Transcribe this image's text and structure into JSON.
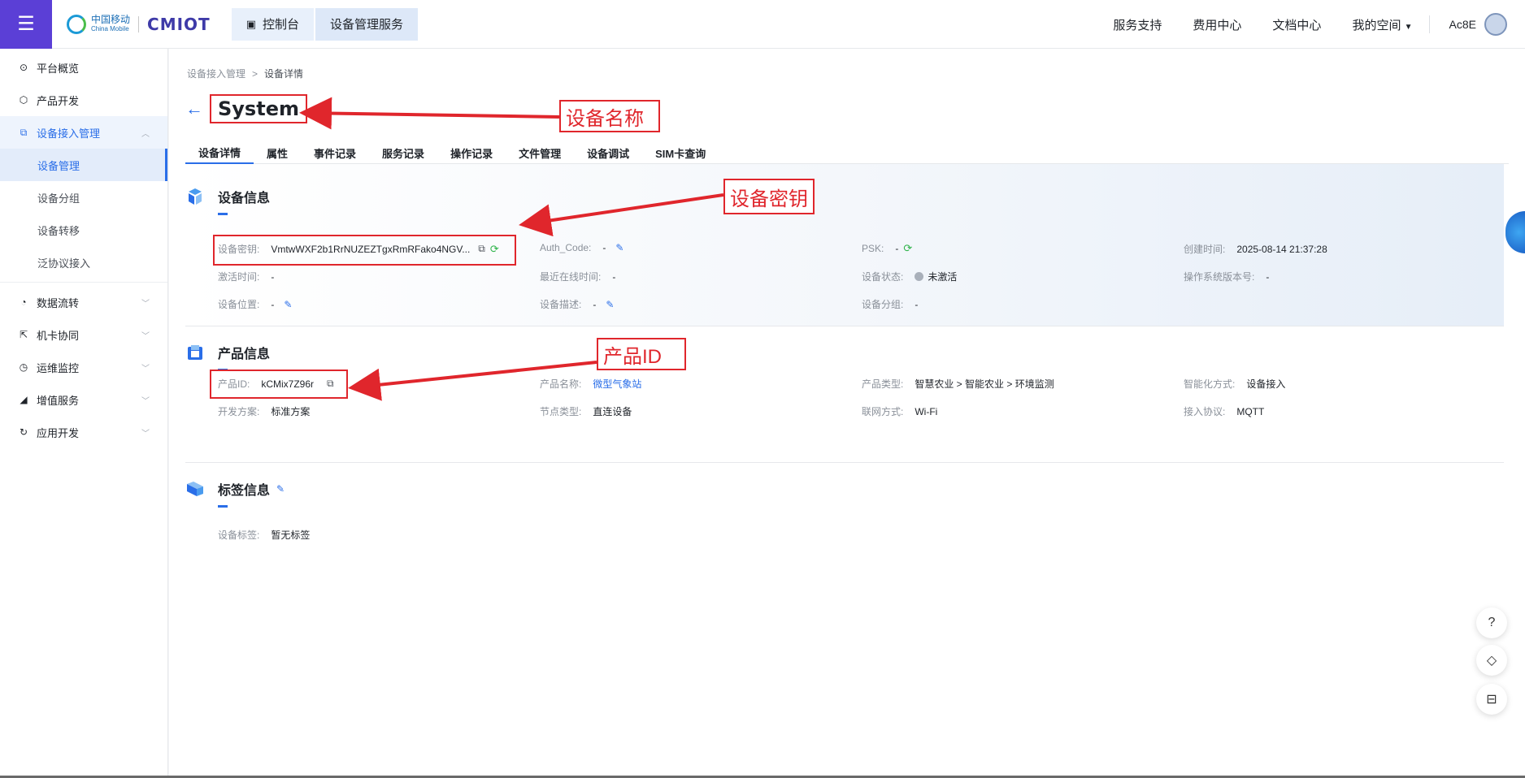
{
  "header": {
    "logo_cn": "中国移动",
    "logo_en": "China Mobile",
    "brand": "CMIOT",
    "crumbs": [
      "控制台",
      "设备管理服务"
    ],
    "links": [
      "服务支持",
      "费用中心",
      "文档中心",
      "我的空间"
    ],
    "username": "Ac8E"
  },
  "sidebar": {
    "items": [
      {
        "label": "平台概览",
        "icon": "dashboard-icon"
      },
      {
        "label": "产品开发",
        "icon": "cube-icon"
      },
      {
        "label": "设备接入管理",
        "icon": "device-icon"
      }
    ],
    "subitems": [
      "设备管理",
      "设备分组",
      "设备转移",
      "泛协议接入"
    ],
    "groups": [
      {
        "label": "数据流转",
        "icon": "flow-icon"
      },
      {
        "label": "机卡协同",
        "icon": "link-icon"
      },
      {
        "label": "运维监控",
        "icon": "monitor-icon"
      },
      {
        "label": "增值服务",
        "icon": "service-icon"
      },
      {
        "label": "应用开发",
        "icon": "app-icon"
      }
    ]
  },
  "breadcrumb": {
    "parent": "设备接入管理",
    "current": "设备详情"
  },
  "device": {
    "name": "System"
  },
  "tabs": [
    "设备详情",
    "属性",
    "事件记录",
    "服务记录",
    "操作记录",
    "文件管理",
    "设备调试",
    "SIM卡查询"
  ],
  "device_info": {
    "title": "设备信息",
    "fields": {
      "key_label": "设备密钥:",
      "key_value": "VmtwWXF2b1RrNUZEZTgxRmRFako4NGV...",
      "auth_label": "Auth_Code:",
      "auth_value": "-",
      "psk_label": "PSK:",
      "psk_value": "-",
      "created_label": "创建时间:",
      "created_value": "2025-08-14 21:37:28",
      "activated_label": "激活时间:",
      "activated_value": "-",
      "lastonline_label": "最近在线时间:",
      "lastonline_value": "-",
      "status_label": "设备状态:",
      "status_value": "未激活",
      "os_label": "操作系统版本号:",
      "os_value": "-",
      "location_label": "设备位置:",
      "location_value": "-",
      "desc_label": "设备描述:",
      "desc_value": "-",
      "group_label": "设备分组:",
      "group_value": "-"
    }
  },
  "product_info": {
    "title": "产品信息",
    "fields": {
      "pid_label": "产品ID:",
      "pid_value": "kCMix7Z96r",
      "pname_label": "产品名称:",
      "pname_value": "微型气象站",
      "ptype_label": "产品类型:",
      "ptype_value": "智慧农业 > 智能农业 > 环境监测",
      "smart_label": "智能化方式:",
      "smart_value": "设备接入",
      "plan_label": "开发方案:",
      "plan_value": "标准方案",
      "node_label": "节点类型:",
      "node_value": "直连设备",
      "net_label": "联网方式:",
      "net_value": "Wi-Fi",
      "proto_label": "接入协议:",
      "proto_value": "MQTT"
    }
  },
  "tag_info": {
    "title": "标签信息",
    "tag_label": "设备标签:",
    "tag_value": "暂无标签"
  },
  "annotations": {
    "device_name": "设备名称",
    "device_key": "设备密钥",
    "product_id": "产品ID"
  },
  "colors": {
    "accent": "#2a6ee8",
    "menu_bg": "#5b3fd6",
    "annotation_red": "#e0262c"
  }
}
